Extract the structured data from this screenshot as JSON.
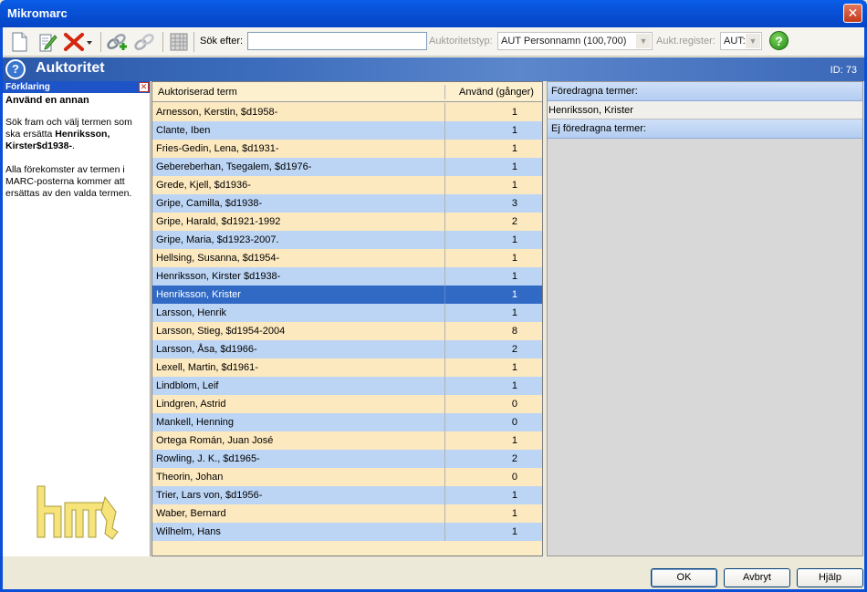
{
  "window": {
    "title": "Mikromarc",
    "close_glyph": "✕"
  },
  "toolbar": {
    "search_label": "Sök efter:",
    "search_value": "",
    "authtype_label": "Auktoritetstyp:",
    "authtype_value": "AUT Personnamn (100,700)",
    "register_label": "Aukt.register:",
    "register_value": "AUT:",
    "help_glyph": "?",
    "icons": [
      "new-document-icon",
      "edit-document-icon",
      "delete-icon",
      "dropdown-arrow-icon",
      "link-add-icon",
      "link-icon",
      "table-grid-icon",
      "help-icon"
    ]
  },
  "header": {
    "title": "Auktoritet",
    "id_text": "ID: 73",
    "icon_glyph": "?"
  },
  "explain": {
    "head": "Förklaring",
    "title": "Använd en annan",
    "p1_a": "Sök fram och välj termen som ska ersätta ",
    "p1_b": "Henriksson, Kirster$d1938-",
    "p1_c": ".",
    "p2": "Alla förekomster av termen i MARC-posterna kommer att ersättas av den valda termen."
  },
  "table": {
    "col_term": "Auktoriserad term",
    "col_count": "Använd (gånger)",
    "selected_index": 10,
    "rows": [
      {
        "term": "Arnesson, Kerstin, $d1958-",
        "count": "1"
      },
      {
        "term": "Clante, Iben",
        "count": "1"
      },
      {
        "term": "Fries-Gedin, Lena, $d1931-",
        "count": "1"
      },
      {
        "term": "Gebereberhan, Tsegalem, $d1976-",
        "count": "1"
      },
      {
        "term": "Grede, Kjell, $d1936-",
        "count": "1"
      },
      {
        "term": "Gripe, Camilla, $d1938-",
        "count": "3"
      },
      {
        "term": "Gripe, Harald, $d1921-1992",
        "count": "2"
      },
      {
        "term": "Gripe, Maria, $d1923-2007.",
        "count": "1"
      },
      {
        "term": "Hellsing, Susanna, $d1954-",
        "count": "1"
      },
      {
        "term": "Henriksson, Kirster $d1938-",
        "count": "1"
      },
      {
        "term": "Henriksson, Krister",
        "count": "1"
      },
      {
        "term": "Larsson, Henrik",
        "count": "1"
      },
      {
        "term": "Larsson, Stieg, $d1954-2004",
        "count": "8"
      },
      {
        "term": "Larsson, Åsa, $d1966-",
        "count": "2"
      },
      {
        "term": "Lexell, Martin, $d1961-",
        "count": "1"
      },
      {
        "term": "Lindblom, Leif",
        "count": "1"
      },
      {
        "term": "Lindgren, Astrid",
        "count": "0"
      },
      {
        "term": "Mankell, Henning",
        "count": "0"
      },
      {
        "term": "Ortega Román, Juan José",
        "count": "1"
      },
      {
        "term": "Rowling, J. K., $d1965-",
        "count": "2"
      },
      {
        "term": "Theorin, Johan",
        "count": "0"
      },
      {
        "term": "Trier, Lars von, $d1956-",
        "count": "1"
      },
      {
        "term": "Waber, Bernard",
        "count": "1"
      },
      {
        "term": "Wilhelm, Hans",
        "count": "1"
      }
    ]
  },
  "right": {
    "preferred_label": "Föredragna termer:",
    "preferred_value": "Henriksson, Krister",
    "nonpreferred_label": "Ej föredragna termer:"
  },
  "buttons": {
    "ok": "OK",
    "cancel": "Avbryt",
    "help": "Hjälp"
  },
  "colors": {
    "selected_row": "#316ac5",
    "row_odd": "#fde9bf",
    "row_even": "#bcd5f5",
    "title_bar": "#0852d8"
  }
}
